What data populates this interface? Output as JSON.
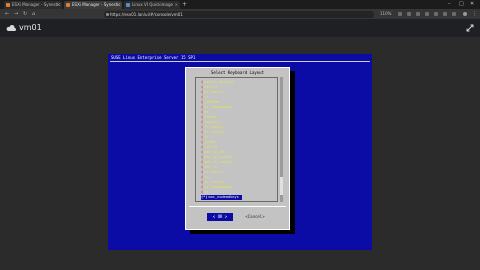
{
  "browser": {
    "tabs": [
      {
        "label": "ESXi Manager - Synestic"
      },
      {
        "label": "ESXi Manager - Synestic"
      },
      {
        "label": "Linux VI Quickimage"
      }
    ],
    "new_tab": "+",
    "url": "https://esx01.lan/ui/#/console/vm01",
    "zoom": "110%"
  },
  "vm": {
    "title": "vm01"
  },
  "console": {
    "title": "SUSE Linux Enterprise Server 15 SP1",
    "dialog_title": "Select Keyboard Layout",
    "items": [
      "azerty_belgian",
      "azerty",
      "be_latin1",
      "cf",
      "colemak",
      "de_nodeadkeys",
      "de",
      "dvorak",
      "dvorak_r",
      "fr_latin1",
      "fr_latin9",
      "fr",
      "jp106",
      "latin1",
      "mac_de_ch",
      "mac_de_latin1",
      "mac_fr_latin1",
      "mac_us",
      "no_latin1",
      "ru",
      "sg_latin1",
      "sg_nodeadkeys",
      "us",
      "uk",
      "us_acentos"
    ],
    "selected_item": "mac_nodeadkeys",
    "ok_label": "< OK >",
    "cancel_label": "<Cancel>"
  }
}
